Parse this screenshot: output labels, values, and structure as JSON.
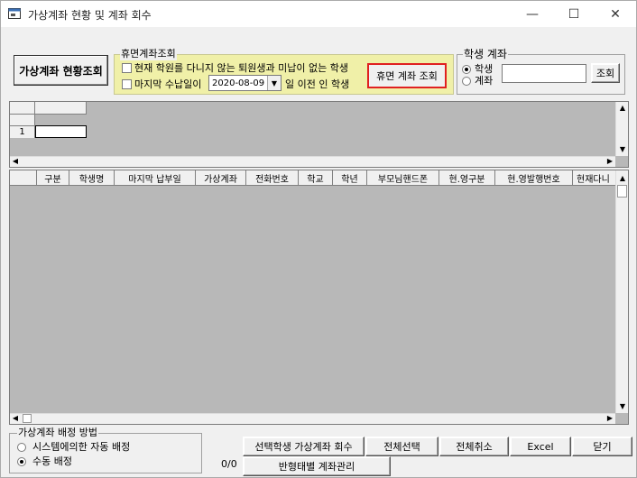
{
  "window": {
    "title": "가상계좌 현황 및 계좌 회수",
    "controls": {
      "minimize": "—",
      "maximize": "☐",
      "close": "✕"
    },
    "icon": "app-window-icon"
  },
  "toolbar": {
    "status_button": "가상계좌 현황조회"
  },
  "dormant": {
    "legend": "휴면계좌조회",
    "option1": "현재 학원를 다니지 않는 퇴원생과 미납이 없는 학생",
    "option2_prefix": "마지막 수납일이",
    "date_value": "2020-08-09",
    "option2_suffix": "일 이전 인 학생",
    "search_button": "휴면 계좌 조회"
  },
  "student_account": {
    "legend": "학생 계좌",
    "radio_student": "학생",
    "radio_account": "계좌",
    "search_value": "",
    "search_button": "조회"
  },
  "top_grid": {
    "row_number": "1"
  },
  "main_grid": {
    "columns": [
      "구분",
      "학생명",
      "마지막 납부일",
      "가상계좌",
      "전화번호",
      "학교",
      "학년",
      "부모님핸드폰",
      "현.영구분",
      "현.영발행번호",
      "현재다니"
    ]
  },
  "assign": {
    "legend": "가상계좌 배정 방법",
    "auto": "시스템에의한 자동 배정",
    "manual": "수동 배정"
  },
  "footer": {
    "count": "0/0",
    "reclaim_button": "선택학생 가상계좌 회수",
    "select_all_button": "전체선택",
    "cancel_all_button": "전체취소",
    "excel_button": "Excel",
    "close_button": "닫기",
    "class_manage_button": "반형태별 계좌관리"
  },
  "colors": {
    "highlight": "#f0f0a8",
    "red_outline": "#e02020",
    "grid_bg": "#b8b8b8"
  }
}
